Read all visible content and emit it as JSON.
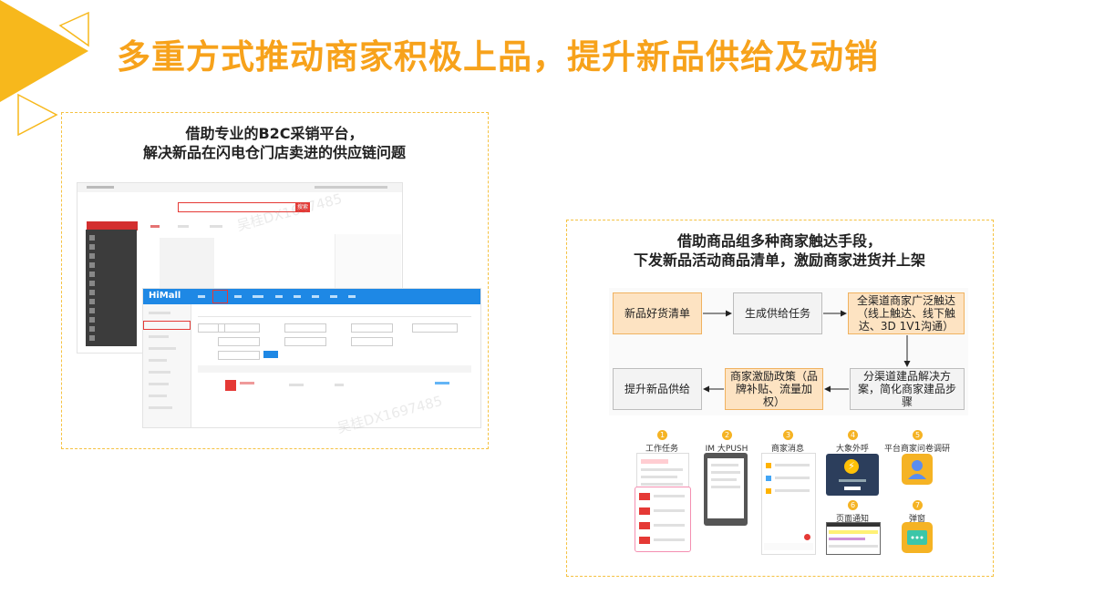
{
  "title": "多重方式推动商家积极上品，提升新品供给及动销",
  "left_panel": {
    "caption_line1": "借助专业的B2C采销平台，",
    "caption_line2": "解决新品在闪电仓门店卖进的供应链问题",
    "screenshot": {
      "brand": "HiMall",
      "search_button": "搜索",
      "watermark": "吴桂DX1697485"
    }
  },
  "right_panel": {
    "caption_line1": "借助商品组多种商家触达手段，",
    "caption_line2": "下发新品活动商品清单，激励商家进货并上架",
    "flow": {
      "step1": "新品好货清单",
      "step2": "生成供给任务",
      "step3": "全渠道商家广泛触达（线上触达、线下触达、3D 1V1沟通）",
      "step4": "分渠道建品解决方案，简化商家建品步骤",
      "step5": "商家激励政策（品牌补贴、流量加权）",
      "step6": "提升新品供给"
    },
    "channels": [
      {
        "num": "1",
        "label": "工作任务"
      },
      {
        "num": "2",
        "label": "IM 大PUSH"
      },
      {
        "num": "3",
        "label": "商家消息"
      },
      {
        "num": "4",
        "label": "大象外呼"
      },
      {
        "num": "5",
        "label": "平台商家问卷调研"
      },
      {
        "num": "6",
        "label": "页面通知"
      },
      {
        "num": "7",
        "label": "弹窗"
      }
    ]
  },
  "colors": {
    "accent": "#f7a21b",
    "dashed_border": "#f5c242",
    "himall_blue": "#1e88e5"
  }
}
